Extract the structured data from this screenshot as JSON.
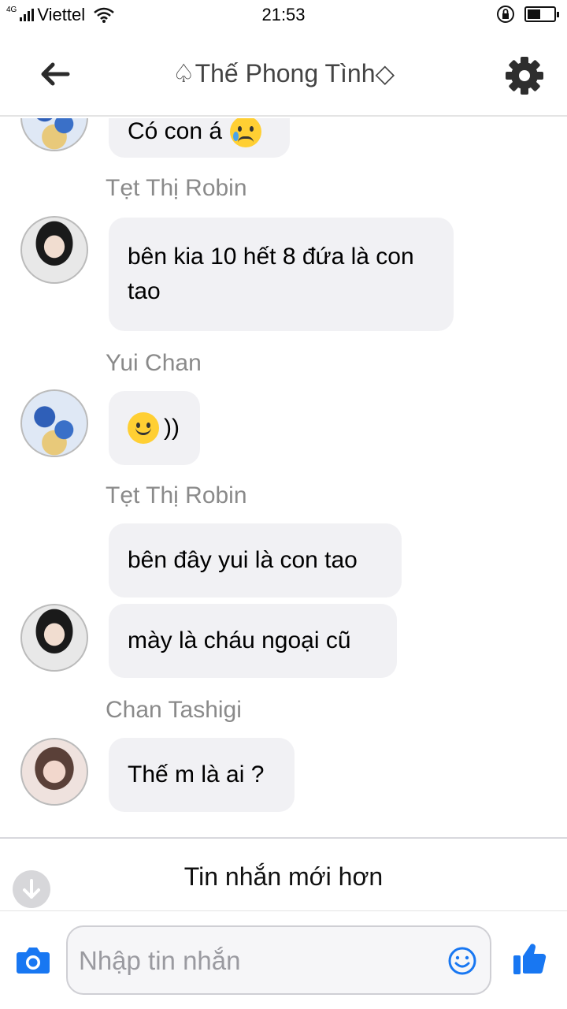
{
  "status_bar": {
    "network_type": "4G",
    "carrier": "Viettel",
    "time": "21:53",
    "battery_level": 0.5
  },
  "header": {
    "title": "♤Thế Phong Tình◇",
    "back_icon": "arrow-left-icon",
    "settings_icon": "gear-icon"
  },
  "messages": {
    "partial_first": {
      "text": "Có con á",
      "emoji": "sad-tear-emoji"
    },
    "groups": [
      {
        "sender": "Tẹt Thị Robin",
        "bubbles": [
          "bên kia 10 hết 8 đứa là con tao"
        ]
      },
      {
        "sender": "Yui Chan",
        "bubbles": [
          "))"
        ],
        "emoji": "smile-emoji"
      },
      {
        "sender": "Tẹt Thị Robin",
        "bubbles": [
          "bên đây yui là con tao",
          "mày là cháu ngoại cũ"
        ]
      },
      {
        "sender": "Chan Tashigi",
        "bubbles": [
          "Thế m là ai ?"
        ]
      }
    ]
  },
  "newer_bar": {
    "label": "Tin nhắn mới hơn",
    "icon": "arrow-down-icon"
  },
  "composer": {
    "placeholder": "Nhập tin nhắn",
    "value": "",
    "camera_icon": "camera-icon",
    "emoji_icon": "smile-icon",
    "like_icon": "thumbs-up-icon",
    "accent_color": "#1877f2"
  }
}
